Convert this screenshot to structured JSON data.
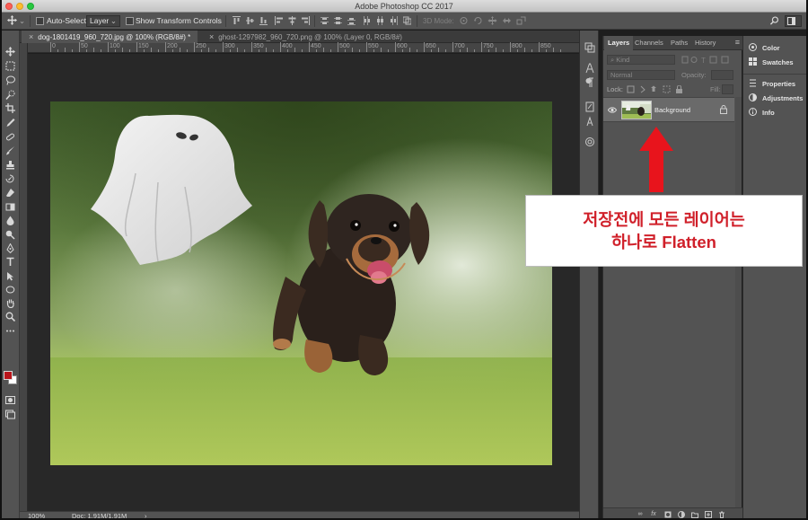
{
  "window": {
    "title": "Adobe Photoshop CC 2017"
  },
  "options_bar": {
    "auto_select_label": "Auto-Select:",
    "auto_select_value": "Layer",
    "show_transform_label": "Show Transform Controls",
    "mode_3d_label": "3D Mode:"
  },
  "document_tabs": [
    {
      "close": "×",
      "label": "dog-1801419_960_720.jpg @ 100% (RGB/8#) *"
    },
    {
      "close": "×",
      "label": "ghost-1297982_960_720.png @ 100% (Layer 0, RGB/8#)"
    }
  ],
  "ruler": {
    "marks": [
      "0",
      "50",
      "100",
      "150",
      "200",
      "250",
      "300",
      "350",
      "400",
      "450",
      "500",
      "550",
      "600",
      "650",
      "700",
      "750",
      "800",
      "850"
    ]
  },
  "status_bar": {
    "zoom": "100%",
    "doc": "Doc: 1.91M/1.91M",
    "arrow": "›"
  },
  "layers_panel": {
    "tabs": [
      "Layers",
      "Channels",
      "Paths",
      "History"
    ],
    "filter_label": "Kind",
    "blend_mode": "Normal",
    "opacity_label": "Opacity:",
    "lock_label": "Lock:",
    "fill_label": "Fill:",
    "layer": {
      "name": "Background"
    }
  },
  "right_panel": {
    "items": [
      "Color",
      "Swatches",
      "Properties",
      "Adjustments",
      "Info"
    ]
  },
  "annotation": {
    "line1": "저장전에 모든 레이어는",
    "line2": "하나로 Flatten",
    "color": "#d0202a",
    "arrow_color": "#e8141c"
  },
  "colors": {
    "foreground": "#b9151b",
    "background": "#ffffff",
    "panel": "#535353"
  },
  "icons": {
    "tools": [
      "move-icon",
      "marquee-icon",
      "lasso-icon",
      "quick-select-icon",
      "crop-icon",
      "eyedropper-icon",
      "healing-icon",
      "brush-icon",
      "clone-stamp-icon",
      "history-brush-icon",
      "eraser-icon",
      "gradient-icon",
      "blur-icon",
      "dodge-icon",
      "pen-icon",
      "type-icon",
      "path-select-icon",
      "shape-icon",
      "hand-icon",
      "zoom-icon",
      "more-tools-icon"
    ]
  }
}
